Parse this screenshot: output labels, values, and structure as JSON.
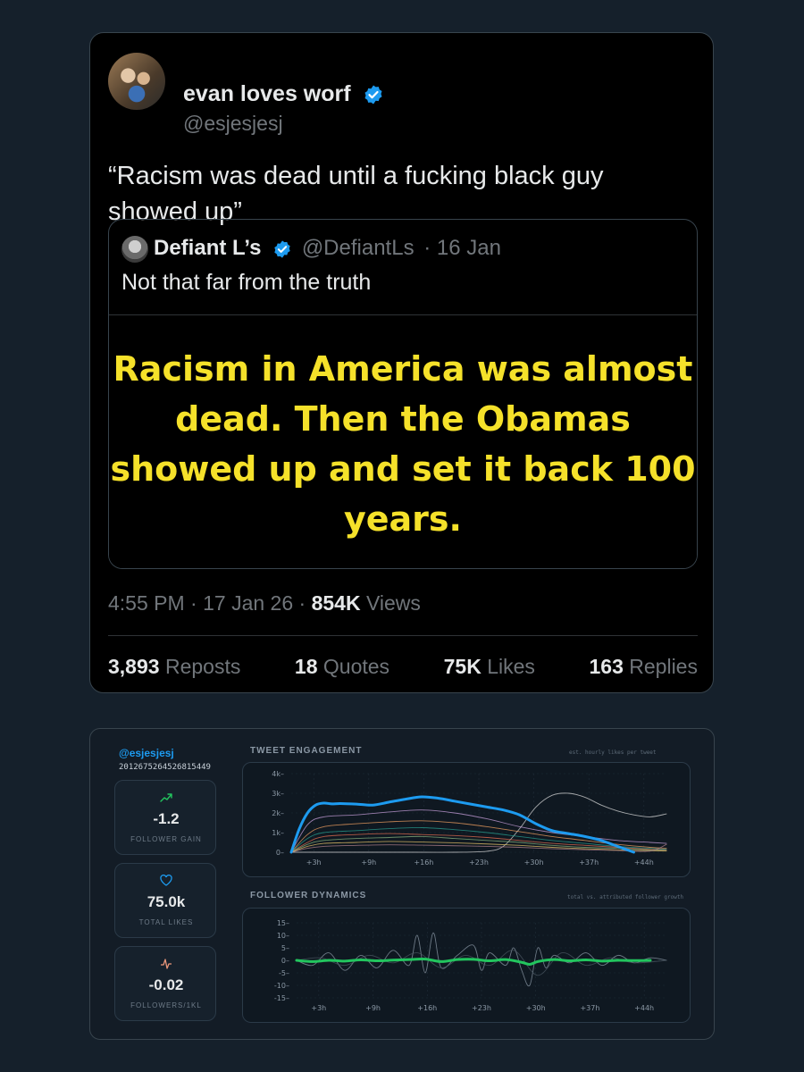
{
  "tweet": {
    "display_name": "evan loves worf",
    "handle": "@esjesjesj",
    "text": "“Racism was dead until a fucking black guy showed up”",
    "quoted": {
      "name": "Defiant L’s",
      "handle": "@DefiantLs",
      "date": "· 16 Jan",
      "text": "Not that far from the truth",
      "image_text": "Racism in America was almost dead. Then the Obamas showed up and set it back 100 years."
    },
    "time": "4:55 PM · 17 Jan 26 ·",
    "views_count": "854K",
    "views_label": "Views",
    "stats": [
      {
        "count": "3,893",
        "label": "Reposts"
      },
      {
        "count": "18",
        "label": "Quotes"
      },
      {
        "count": "75K",
        "label": "Likes"
      },
      {
        "count": "163",
        "label": "Replies"
      }
    ],
    "colors": {
      "verified": "#1d9bf0",
      "image_text": "#f5e12a"
    }
  },
  "analytics": {
    "handle": "@esjesjesj",
    "user_id": "2012675264526815449",
    "cards": [
      {
        "icon": "trending-up-icon",
        "value": "-1.2",
        "label": "FOLLOWER GAIN",
        "color": "#22c55e"
      },
      {
        "icon": "heart-icon",
        "value": "75.0k",
        "label": "TOTAL LIKES",
        "color": "#1d9bf0"
      },
      {
        "icon": "pulse-icon",
        "value": "-0.02",
        "label": "FOLLOWERS/1KL",
        "color": "#e9967a"
      }
    ]
  },
  "chart_data": [
    {
      "type": "line",
      "title": "TWEET ENGAGEMENT",
      "subtitle": "est. hourly likes per tweet",
      "x_ticks": [
        "+3h",
        "+9h",
        "+16h",
        "+23h",
        "+30h",
        "+37h",
        "+44h"
      ],
      "y_ticks": [
        "0",
        "1k",
        "2k",
        "3k",
        "4k"
      ],
      "ylim": [
        0,
        4000
      ],
      "xlim": [
        0,
        46
      ],
      "series": [
        {
          "color": "#1d9bf0",
          "highlight": true,
          "x": [
            0,
            1,
            2,
            3,
            4,
            5,
            6,
            8,
            10,
            12,
            14,
            16,
            18,
            20,
            22,
            24,
            26,
            28,
            30,
            32,
            34,
            36,
            38,
            40,
            42
          ],
          "y": [
            0,
            1200,
            2000,
            2400,
            2500,
            2460,
            2480,
            2450,
            2400,
            2550,
            2700,
            2820,
            2750,
            2600,
            2450,
            2300,
            2150,
            1900,
            1450,
            1100,
            950,
            800,
            600,
            300,
            0
          ]
        },
        {
          "color": "#d9d9d9",
          "x": [
            0,
            15,
            20,
            24,
            26,
            28,
            30,
            32,
            34,
            36,
            38,
            40,
            42,
            44,
            46
          ],
          "y": [
            0,
            0,
            0,
            50,
            300,
            1200,
            2300,
            2900,
            3000,
            2800,
            2400,
            2100,
            1900,
            1800,
            1950
          ]
        },
        {
          "color": "#c9a0dc",
          "x": [
            0,
            2,
            4,
            8,
            12,
            16,
            20,
            24,
            28,
            32,
            36,
            40,
            44,
            46
          ],
          "y": [
            0,
            1400,
            1800,
            1900,
            2050,
            2150,
            2000,
            1700,
            1300,
            1000,
            800,
            600,
            500,
            450
          ]
        },
        {
          "color": "#f4a261",
          "x": [
            0,
            2,
            4,
            8,
            12,
            16,
            20,
            24,
            28,
            32,
            36,
            40,
            44,
            46
          ],
          "y": [
            0,
            900,
            1300,
            1450,
            1550,
            1600,
            1500,
            1300,
            1050,
            800,
            600,
            400,
            250,
            200
          ]
        },
        {
          "color": "#2a9d8f",
          "x": [
            0,
            2,
            4,
            8,
            12,
            16,
            20,
            24,
            28,
            32,
            36,
            40,
            44,
            46
          ],
          "y": [
            0,
            700,
            1000,
            1100,
            1200,
            1250,
            1150,
            1000,
            800,
            600,
            450,
            300,
            200,
            150
          ]
        },
        {
          "color": "#e76f51",
          "x": [
            0,
            2,
            4,
            8,
            12,
            16,
            20,
            24,
            28,
            32,
            36,
            40,
            44,
            46
          ],
          "y": [
            0,
            500,
            800,
            900,
            950,
            900,
            850,
            750,
            600,
            450,
            350,
            250,
            150,
            120
          ]
        },
        {
          "color": "#8ab17d",
          "x": [
            0,
            2,
            4,
            8,
            12,
            16,
            20,
            24,
            28,
            32,
            36,
            40,
            44,
            46
          ],
          "y": [
            0,
            400,
            600,
            700,
            750,
            800,
            700,
            600,
            500,
            350,
            250,
            200,
            120,
            100
          ]
        },
        {
          "color": "#e9c46a",
          "x": [
            0,
            2,
            4,
            8,
            12,
            16,
            20,
            24,
            28,
            32,
            36,
            40,
            44,
            46
          ],
          "y": [
            0,
            300,
            450,
            500,
            550,
            520,
            480,
            420,
            350,
            250,
            180,
            120,
            80,
            60
          ]
        },
        {
          "color": "#b5838d",
          "x": [
            0,
            2,
            4,
            8,
            12,
            16,
            20,
            24,
            28,
            32,
            36,
            40,
            44,
            46
          ],
          "y": [
            0,
            200,
            300,
            350,
            380,
            360,
            330,
            300,
            250,
            180,
            130,
            90,
            60,
            400
          ]
        }
      ]
    },
    {
      "type": "line",
      "title": "FOLLOWER DYNAMICS",
      "subtitle": "total vs. attributed follower growth",
      "x_ticks": [
        "+3h",
        "+9h",
        "+16h",
        "+23h",
        "+30h",
        "+37h",
        "+44h"
      ],
      "y_ticks": [
        "15",
        "10",
        "5",
        "0",
        "-5",
        "-10",
        "-15"
      ],
      "ylim": [
        -15,
        15
      ],
      "xlim": [
        0,
        46
      ],
      "series": [
        {
          "color": "#8b98a5",
          "x": [
            0,
            2,
            4,
            6,
            8,
            10,
            12,
            14,
            15,
            16,
            17,
            18,
            20,
            22,
            23,
            24,
            26,
            27,
            28,
            29,
            30,
            31,
            32,
            34,
            36,
            38,
            40,
            42,
            44,
            46
          ],
          "y": [
            0,
            -2,
            3,
            -4,
            2,
            -3,
            4,
            -2,
            10,
            -5,
            11,
            -3,
            2,
            6,
            -4,
            3,
            -2,
            5,
            -4,
            -10,
            5,
            -3,
            2,
            -1,
            3,
            -2,
            2,
            -1,
            1,
            0
          ]
        },
        {
          "color": "#4a5560",
          "x": [
            0,
            3,
            6,
            9,
            12,
            15,
            18,
            21,
            24,
            27,
            30,
            33,
            36,
            39,
            42,
            46
          ],
          "y": [
            0,
            1,
            -2,
            2,
            -1,
            3,
            -3,
            2,
            -2,
            4,
            -6,
            3,
            -2,
            1,
            -1,
            0
          ]
        },
        {
          "color": "#22c55e",
          "highlight": true,
          "x": [
            0,
            2,
            4,
            6,
            8,
            10,
            12,
            14,
            16,
            18,
            20,
            22,
            24,
            26,
            28,
            29,
            30,
            32,
            34,
            36,
            38,
            40,
            42,
            44
          ],
          "y": [
            0,
            -0.5,
            0,
            -0.3,
            0.2,
            -0.2,
            0.1,
            0.3,
            0.5,
            -0.5,
            0.3,
            0.4,
            -0.2,
            0.3,
            -0.8,
            -1.6,
            -0.5,
            0.3,
            -0.2,
            0.2,
            -0.3,
            0,
            -0.1,
            0
          ]
        }
      ]
    }
  ]
}
